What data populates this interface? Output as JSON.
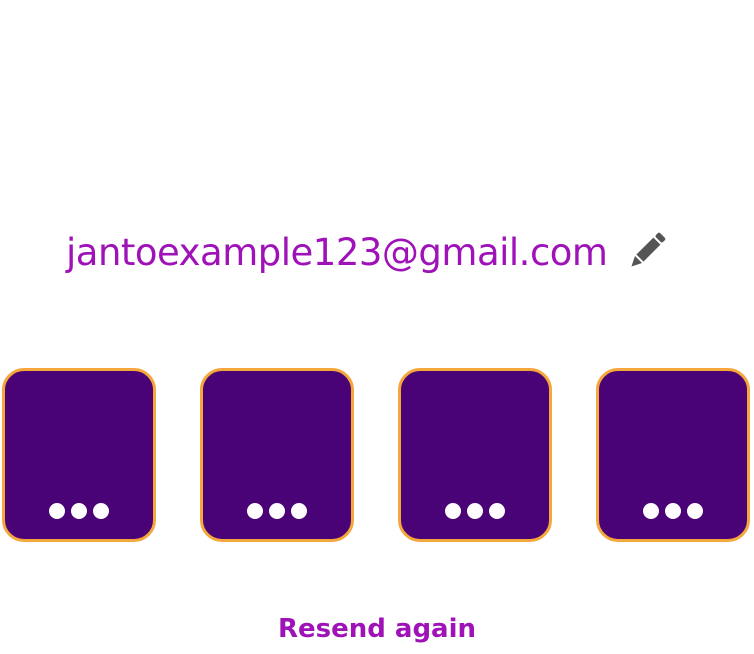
{
  "verification": {
    "email": "jantoexample123@gmail.com",
    "edit_icon": "pencil-icon",
    "code_digits": [
      "•••",
      "•••",
      "•••",
      "•••"
    ],
    "resend_label": "Resend again"
  },
  "colors": {
    "accent": "#9E12B8",
    "box_fill": "#4A0277",
    "box_border": "#F4A73B",
    "icon": "#555555",
    "background": "#FFFFFF"
  }
}
